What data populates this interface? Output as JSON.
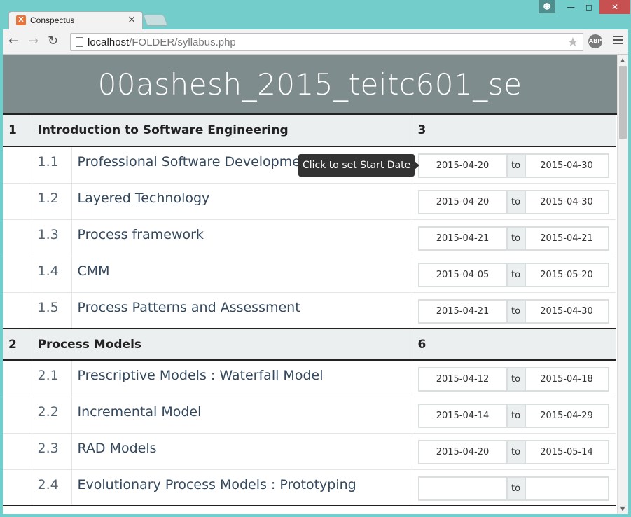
{
  "browser": {
    "tab_title": "Conspectus",
    "tab_favicon": "X",
    "url_host": "localhost",
    "url_path": "/FOLDER/syllabus.php"
  },
  "page": {
    "heading": "00ashesh_2015_teitc601_se",
    "tooltip": "Click to set Start Date",
    "to_label": "to"
  },
  "units": [
    {
      "number": "1",
      "title": "Introduction to Software Engineering",
      "hours": "3",
      "topics": [
        {
          "number": "1.1",
          "title": "Professional Software Development",
          "start": "2015-04-20",
          "end": "2015-04-30"
        },
        {
          "number": "1.2",
          "title": "Layered Technology",
          "start": "2015-04-20",
          "end": "2015-04-30"
        },
        {
          "number": "1.3",
          "title": "Process framework",
          "start": "2015-04-21",
          "end": "2015-04-21"
        },
        {
          "number": "1.4",
          "title": "CMM",
          "start": "2015-04-05",
          "end": "2015-05-20"
        },
        {
          "number": "1.5",
          "title": "Process Patterns and Assessment",
          "start": "2015-04-21",
          "end": "2015-04-30"
        }
      ]
    },
    {
      "number": "2",
      "title": "Process Models",
      "hours": "6",
      "topics": [
        {
          "number": "2.1",
          "title": "Prescriptive Models : Waterfall Model",
          "start": "2015-04-12",
          "end": "2015-04-18"
        },
        {
          "number": "2.2",
          "title": "Incremental Model",
          "start": "2015-04-14",
          "end": "2015-04-29"
        },
        {
          "number": "2.3",
          "title": "RAD Models",
          "start": "2015-04-20",
          "end": "2015-05-14"
        },
        {
          "number": "2.4",
          "title": "Evolutionary Process Models : Prototyping",
          "start": "",
          "end": ""
        }
      ]
    }
  ]
}
